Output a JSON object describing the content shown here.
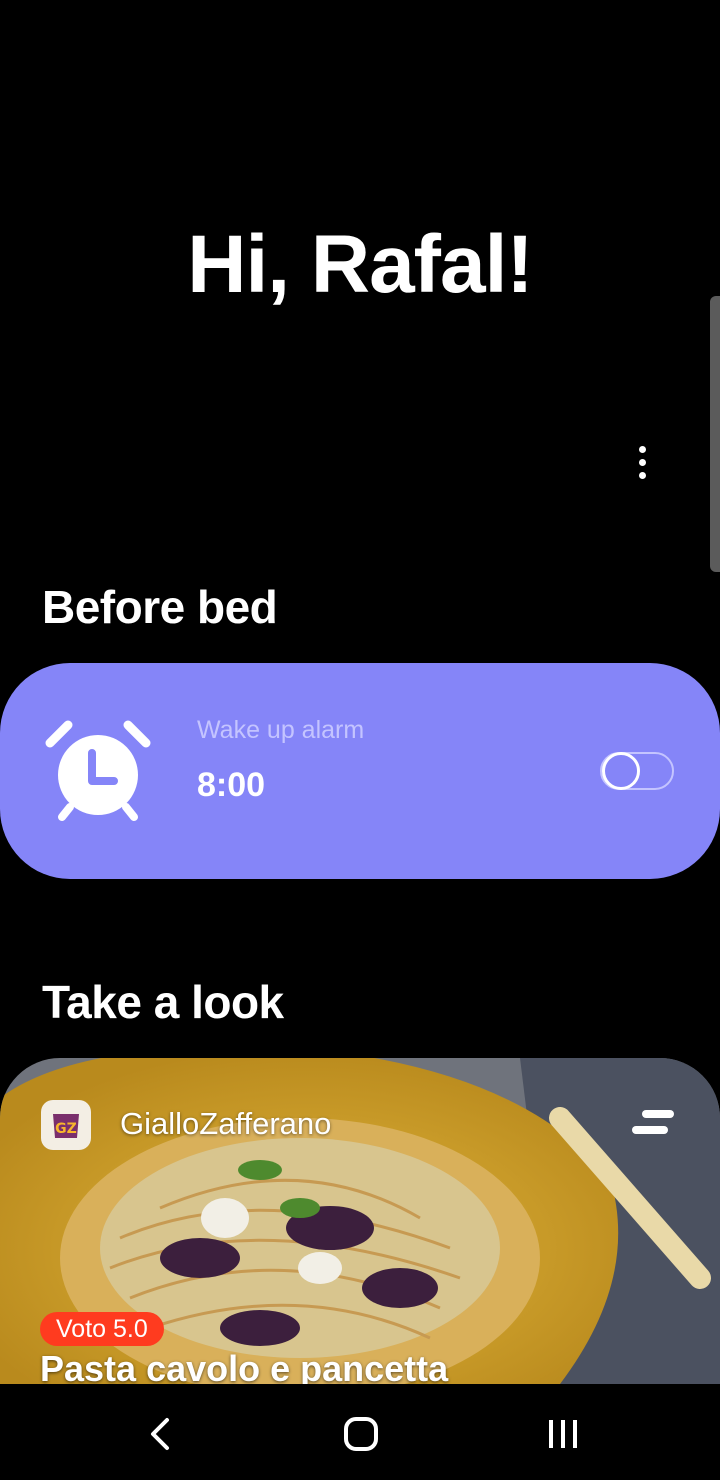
{
  "greeting": "Hi, Rafal!",
  "sections": {
    "before_bed": "Before bed",
    "take_a_look": "Take a look"
  },
  "alarm": {
    "label": "Wake up alarm",
    "time": "8:00",
    "enabled": false,
    "icon": "alarm-clock-icon",
    "card_color": "#8585f8"
  },
  "recipe": {
    "brand": "GialloZafferano",
    "rating": "Voto 5.0",
    "title": "Pasta cavolo e pancetta",
    "badge_color": "#ff3b1f"
  },
  "nav": {
    "back_icon": "back-icon",
    "home_icon": "home-icon",
    "recents_icon": "recents-icon"
  }
}
